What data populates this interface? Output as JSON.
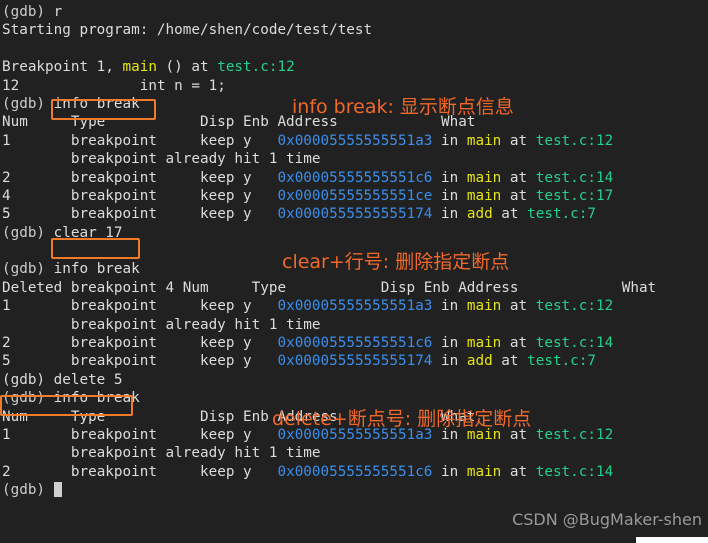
{
  "terminal": {
    "background_color": "#212121",
    "default_text_color": "#dcdcdc",
    "accent_color": "#f0682a",
    "address_color": "#3b8eea",
    "function_color": "#e5e510",
    "file_color": "#23d18b",
    "prompt": "(gdb)",
    "watermark": "CSDN @BugMaker-shen",
    "lines": [
      {
        "id": "l0",
        "prompt": "(gdb) ",
        "text": "r"
      },
      {
        "id": "l1",
        "text": "Starting program: /home/shen/code/test/test"
      },
      {
        "id": "l2",
        "text": ""
      },
      {
        "id": "l3",
        "pre": "Breakpoint 1, ",
        "fn": "main",
        "mid": " () at ",
        "file": "test.c:12"
      },
      {
        "id": "l4",
        "text": "12\t        int n = 1;"
      },
      {
        "id": "l5",
        "prompt": "(gdb) ",
        "cmd": "info break"
      },
      {
        "id": "l6",
        "text": "Num     Type           Disp Enb Address            What"
      },
      {
        "id": "l7",
        "num": "1",
        "type": "breakpoint",
        "disp": "keep y",
        "addr": "0x00005555555551a3",
        "in": " in ",
        "fn": "main",
        "at": " at ",
        "file": "test.c:12"
      },
      {
        "id": "l8",
        "text": "        breakpoint already hit 1 time"
      },
      {
        "id": "l9",
        "num": "2",
        "type": "breakpoint",
        "disp": "keep y",
        "addr": "0x00005555555551c6",
        "in": " in ",
        "fn": "main",
        "at": " at ",
        "file": "test.c:14"
      },
      {
        "id": "l10",
        "num": "4",
        "type": "breakpoint",
        "disp": "keep y",
        "addr": "0x00005555555551ce",
        "in": " in ",
        "fn": "main",
        "at": " at ",
        "file": "test.c:17"
      },
      {
        "id": "l11",
        "num": "5",
        "type": "breakpoint",
        "disp": "keep y",
        "addr": "0x0000555555555174",
        "in": " in ",
        "fn": "add",
        "at": " at ",
        "file": "test.c:7"
      },
      {
        "id": "l12",
        "prompt": "(gdb) ",
        "cmd": "clear 17"
      },
      {
        "id": "l13",
        "text": ""
      },
      {
        "id": "l14",
        "prompt": "(gdb) ",
        "text": "info break"
      },
      {
        "id": "l15",
        "text": "Deleted breakpoint 4 Num     Type           Disp Enb Address            What"
      },
      {
        "id": "l16",
        "num": "1",
        "type": "breakpoint",
        "disp": "keep y",
        "addr": "0x00005555555551a3",
        "in": " in ",
        "fn": "main",
        "at": " at ",
        "file": "test.c:12"
      },
      {
        "id": "l17",
        "text": "        breakpoint already hit 1 time"
      },
      {
        "id": "l18",
        "num": "2",
        "type": "breakpoint",
        "disp": "keep y",
        "addr": "0x00005555555551c6",
        "in": " in ",
        "fn": "main",
        "at": " at ",
        "file": "test.c:14"
      },
      {
        "id": "l19",
        "num": "5",
        "type": "breakpoint",
        "disp": "keep y",
        "addr": "0x0000555555555174",
        "in": " in ",
        "fn": "add",
        "at": " at ",
        "file": "test.c:7"
      },
      {
        "id": "l20",
        "promptcmd": "(gdb) delete 5"
      },
      {
        "id": "l21",
        "prompt": "(gdb) ",
        "text": "info break"
      },
      {
        "id": "l22",
        "text": "Num     Type           Disp Enb Address            What"
      },
      {
        "id": "l23",
        "num": "1",
        "type": "breakpoint",
        "disp": "keep y",
        "addr": "0x00005555555551a3",
        "in": " in ",
        "fn": "main",
        "at": " at ",
        "file": "test.c:12"
      },
      {
        "id": "l24",
        "text": "        breakpoint already hit 1 time"
      },
      {
        "id": "l25",
        "num": "2",
        "type": "breakpoint",
        "disp": "keep y",
        "addr": "0x00005555555551c6",
        "in": " in ",
        "fn": "main",
        "at": " at ",
        "file": "test.c:14"
      },
      {
        "id": "l26",
        "prompt": "(gdb) ",
        "cursor": true
      }
    ]
  },
  "annotations": [
    {
      "id": "a0",
      "text": "info break: 显示断点信息"
    },
    {
      "id": "a1",
      "text": "clear+行号: 删除指定断点"
    },
    {
      "id": "a2",
      "text": "delete+断点号: 删除指定断点"
    }
  ],
  "highlight_boxes": [
    {
      "id": "b0",
      "label": "info break"
    },
    {
      "id": "b1",
      "label": "clear 17"
    },
    {
      "id": "b2",
      "label": "(gdb) delete 5"
    }
  ]
}
